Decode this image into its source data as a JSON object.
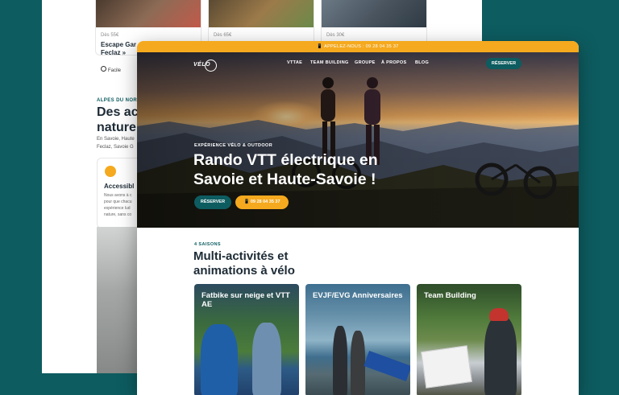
{
  "background_page": {
    "cards": [
      {
        "price": "Dès 55€",
        "title": "Escape Gar\nFeclaz »",
        "difficulty": "Facile"
      },
      {
        "price": "Dès 65€",
        "title": ""
      },
      {
        "price": "Dès 30€",
        "title": ""
      }
    ],
    "kicker": "ALPES DU NORD",
    "heading": "Des act\nnature",
    "body": "En Savoie, Haute\nFeclaz, Savoie G",
    "accessible": {
      "title": "Accessibl",
      "desc": "Nous avons à c\npour que chacu\nexpérience lud\nnature, sans co"
    }
  },
  "site": {
    "topbar_text": "📱 APPELEZ-NOUS : 09 28 04 35 37",
    "logo_text": "VÉLO",
    "nav": {
      "items": [
        "VTTAE",
        "TEAM BUILDING",
        "GROUPE",
        "À PROPOS",
        "BLOG"
      ],
      "cta_label": "RÉSERVER"
    },
    "hero": {
      "kicker": "EXPÉRIENCE VÉLO & OUTDOOR",
      "title": "Rando VTT électrique en Savoie et Haute-Savoie !",
      "btn_reserve": "RÉSERVER",
      "btn_phone": "📱 09 28 04 35 37"
    },
    "section": {
      "kicker": "4 SAISONS",
      "title": "Multi-activités et animations à vélo",
      "cards": [
        {
          "title": "Fatbike sur neige et VTT AE"
        },
        {
          "title": "EVJF/EVG Anniversaires"
        },
        {
          "title": "Team Building"
        }
      ]
    }
  },
  "colors": {
    "brand_teal": "#0d5c60",
    "accent_orange": "#f5a91e"
  }
}
